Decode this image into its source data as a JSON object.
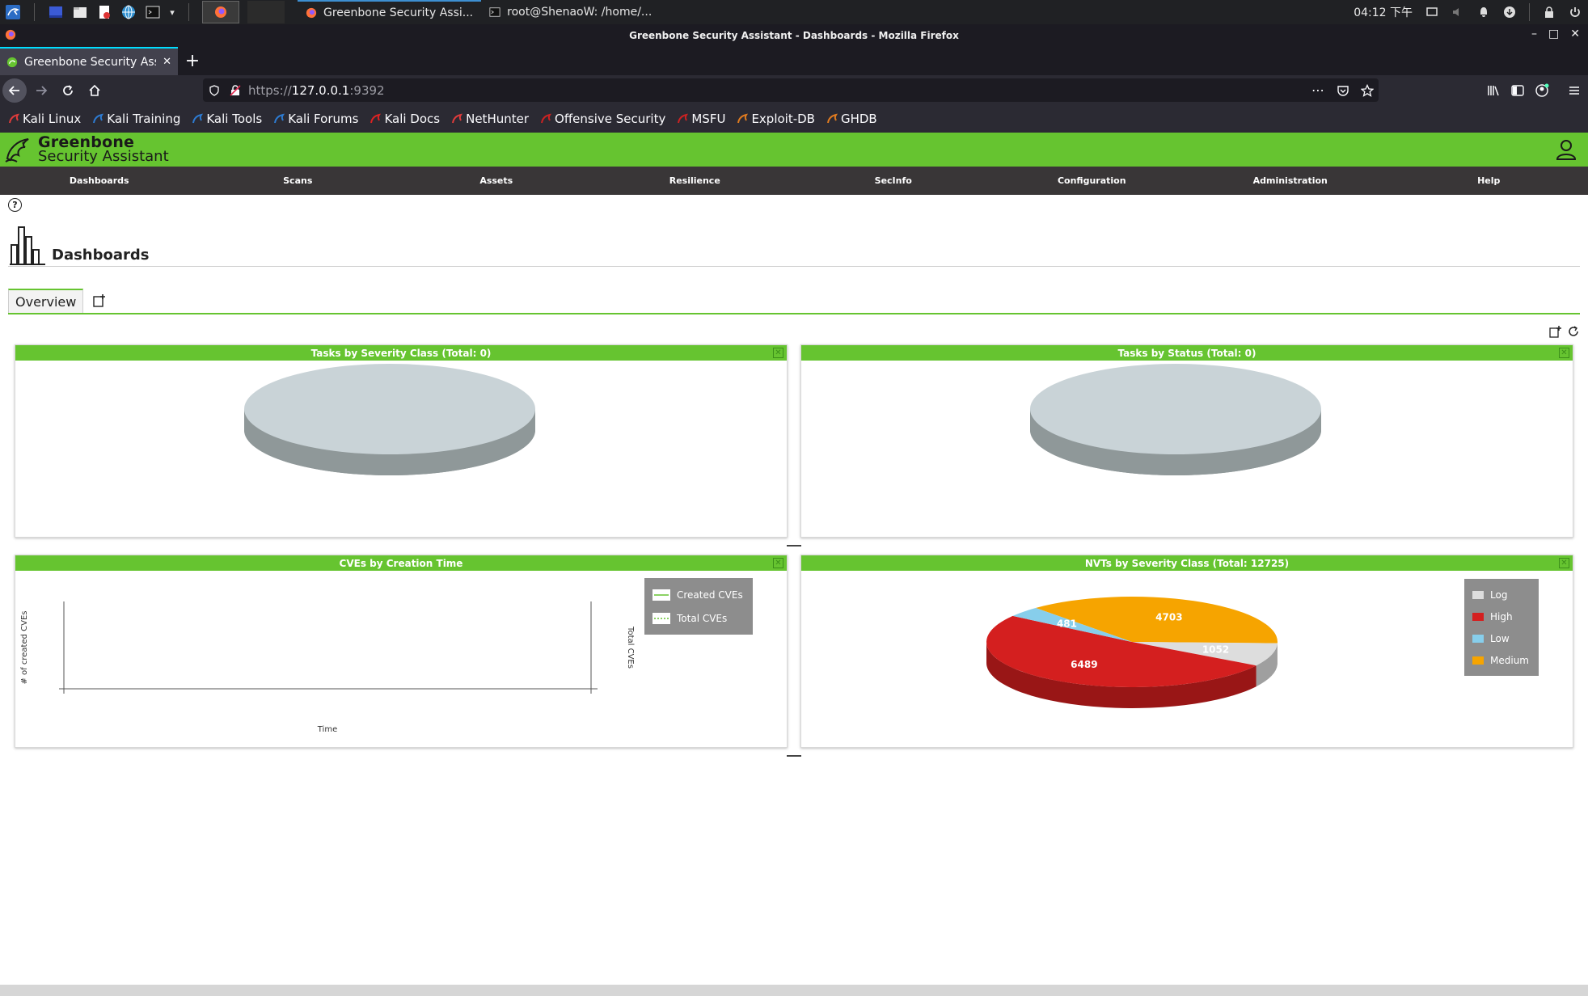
{
  "taskbar": {
    "tasks": [
      {
        "label": "Greenbone Security Assi...",
        "active": true
      },
      {
        "label": "root@ShenaoW: /home/...",
        "active": false
      }
    ],
    "clock": "04:12 下午"
  },
  "browser": {
    "window_title": "Greenbone Security Assistant - Dashboards - Mozilla Firefox",
    "tab_title": "Greenbone Security Assista",
    "url_prefix": "https://",
    "url_host": "127.0.0.1",
    "url_port": ":9392",
    "bookmarks": [
      {
        "label": "Kali Linux",
        "icon": "kali-dragon-icon",
        "color": "#e03b3b"
      },
      {
        "label": "Kali Training",
        "icon": "kali-training-icon",
        "color": "#2d7bd2"
      },
      {
        "label": "Kali Tools",
        "icon": "kali-tools-icon",
        "color": "#2d7bd2"
      },
      {
        "label": "Kali Forums",
        "icon": "kali-forums-icon",
        "color": "#2d7bd2"
      },
      {
        "label": "Kali Docs",
        "icon": "kali-docs-icon",
        "color": "#d22"
      },
      {
        "label": "NetHunter",
        "icon": "nethunter-icon",
        "color": "#e03b3b"
      },
      {
        "label": "Offensive Security",
        "icon": "offsec-icon",
        "color": "#c22"
      },
      {
        "label": "MSFU",
        "icon": "msfu-icon",
        "color": "#c22"
      },
      {
        "label": "Exploit-DB",
        "icon": "exploitdb-icon",
        "color": "#e07b20"
      },
      {
        "label": "GHDB",
        "icon": "ghdb-icon",
        "color": "#e07b20"
      }
    ]
  },
  "app": {
    "logo_line1": "Greenbone",
    "logo_line2": "Security Assistant",
    "menu": [
      "Dashboards",
      "Scans",
      "Assets",
      "Resilience",
      "SecInfo",
      "Configuration",
      "Administration",
      "Help"
    ],
    "help_symbol": "?",
    "page_title": "Dashboards",
    "tabs": [
      "Overview"
    ],
    "colors": {
      "brand_green": "#66c430",
      "menu_bg": "#393637"
    }
  },
  "panels": {
    "tasks_severity": {
      "title": "Tasks by Severity Class (Total: 0)"
    },
    "tasks_status": {
      "title": "Tasks by Status (Total: 0)"
    },
    "cves_time": {
      "title": "CVEs by Creation Time",
      "ylabel": "# of created CVEs",
      "y2label": "Total CVEs",
      "xlabel": "Time",
      "legend": [
        "Created CVEs",
        "Total CVEs"
      ]
    },
    "nvts_severity": {
      "title": "NVTs by Severity Class (Total: 12725)",
      "legend": [
        {
          "label": "Log",
          "color": "#dddddd"
        },
        {
          "label": "High",
          "color": "#d41f1f"
        },
        {
          "label": "Low",
          "color": "#87ceeb"
        },
        {
          "label": "Medium",
          "color": "#f6a400"
        }
      ]
    }
  },
  "chart_data": [
    {
      "type": "pie",
      "title": "Tasks by Severity Class (Total: 0)",
      "slices": []
    },
    {
      "type": "pie",
      "title": "Tasks by Status (Total: 0)",
      "slices": []
    },
    {
      "type": "line",
      "title": "CVEs by Creation Time",
      "xlabel": "Time",
      "ylabel": "# of created CVEs",
      "y2label": "Total CVEs",
      "series": [
        {
          "name": "Created CVEs",
          "values": []
        },
        {
          "name": "Total CVEs",
          "values": []
        }
      ]
    },
    {
      "type": "pie",
      "title": "NVTs by Severity Class (Total: 12725)",
      "slices": [
        {
          "label": "Medium",
          "value": 4703,
          "color": "#f6a400"
        },
        {
          "label": "Log",
          "value": 1052,
          "color": "#dddddd"
        },
        {
          "label": "High",
          "value": 6489,
          "color": "#d41f1f"
        },
        {
          "label": "Low",
          "value": 481,
          "color": "#87ceeb"
        }
      ]
    }
  ]
}
